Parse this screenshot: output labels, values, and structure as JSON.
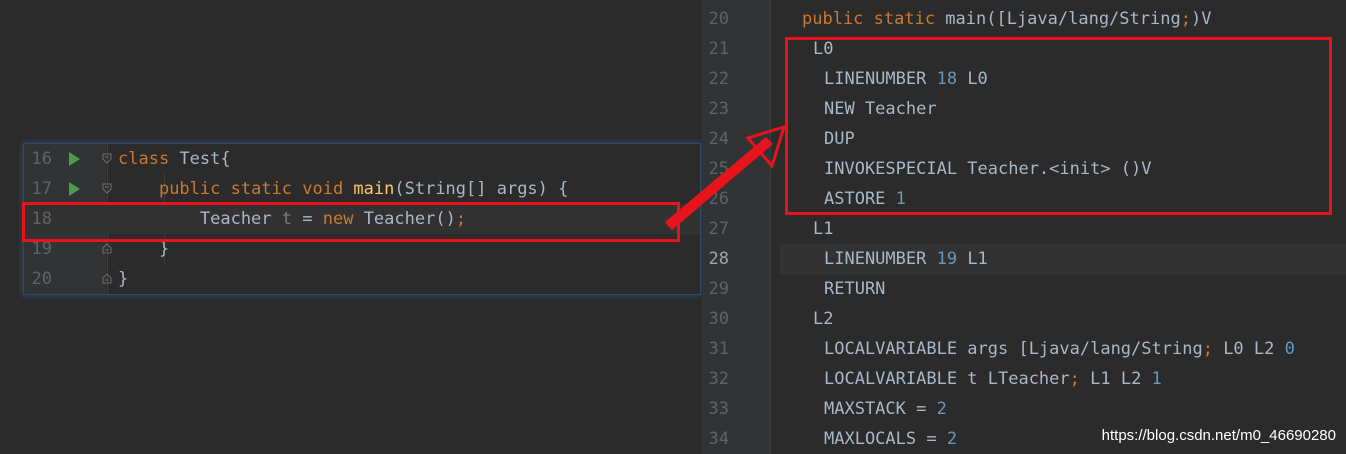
{
  "left_editor": {
    "lines": [
      {
        "num": "16",
        "run": true,
        "tokens": [
          [
            "kw",
            "class"
          ],
          [
            "txt",
            " Test{"
          ]
        ]
      },
      {
        "num": "17",
        "run": true,
        "tokens": [
          [
            "txt",
            "    "
          ],
          [
            "kw",
            "public static void "
          ],
          [
            "fn",
            "main"
          ],
          [
            "txt",
            "(String[] args) {"
          ]
        ]
      },
      {
        "num": "18",
        "run": false,
        "tokens": [
          [
            "txt",
            "        Teacher "
          ],
          [
            "dim",
            "t"
          ],
          [
            "txt",
            " = "
          ],
          [
            "kw",
            "new"
          ],
          [
            "txt",
            " Teacher()"
          ],
          [
            "kw",
            ";"
          ]
        ]
      },
      {
        "num": "19",
        "run": false,
        "tokens": [
          [
            "txt",
            "    }"
          ]
        ]
      },
      {
        "num": "20",
        "run": false,
        "tokens": [
          [
            "txt",
            "}"
          ]
        ]
      }
    ]
  },
  "bytecode": {
    "lines": [
      {
        "num": "20",
        "indent": 0,
        "tokens": [
          [
            "kw",
            "public static "
          ],
          [
            "txt",
            "main([Ljava/lang/String"
          ],
          [
            "kw",
            ";"
          ],
          [
            "txt",
            ")V"
          ]
        ]
      },
      {
        "num": "21",
        "indent": 1,
        "tokens": [
          [
            "txt",
            "L0"
          ]
        ]
      },
      {
        "num": "22",
        "indent": 2,
        "tokens": [
          [
            "txt",
            "LINENUMBER "
          ],
          [
            "num",
            "18"
          ],
          [
            "txt",
            " L0"
          ]
        ]
      },
      {
        "num": "23",
        "indent": 2,
        "tokens": [
          [
            "txt",
            "NEW Teacher"
          ]
        ]
      },
      {
        "num": "24",
        "indent": 2,
        "tokens": [
          [
            "txt",
            "DUP"
          ]
        ]
      },
      {
        "num": "25",
        "indent": 2,
        "tokens": [
          [
            "txt",
            "INVOKESPECIAL Teacher.<init> ()V"
          ]
        ]
      },
      {
        "num": "26",
        "indent": 2,
        "tokens": [
          [
            "txt",
            "ASTORE "
          ],
          [
            "num",
            "1"
          ]
        ]
      },
      {
        "num": "27",
        "indent": 1,
        "tokens": [
          [
            "txt",
            "L1"
          ]
        ]
      },
      {
        "num": "28",
        "indent": 2,
        "tokens": [
          [
            "txt",
            "LINENUMBER "
          ],
          [
            "num",
            "19"
          ],
          [
            "txt",
            " L1"
          ]
        ]
      },
      {
        "num": "29",
        "indent": 2,
        "tokens": [
          [
            "txt",
            "RETURN"
          ]
        ]
      },
      {
        "num": "30",
        "indent": 1,
        "tokens": [
          [
            "txt",
            "L2"
          ]
        ]
      },
      {
        "num": "31",
        "indent": 2,
        "tokens": [
          [
            "txt",
            "LOCALVARIABLE args [Ljava/lang/String"
          ],
          [
            "kw",
            ";"
          ],
          [
            "txt",
            " L0 L2 "
          ],
          [
            "num",
            "0"
          ]
        ]
      },
      {
        "num": "32",
        "indent": 2,
        "tokens": [
          [
            "txt",
            "LOCALVARIABLE t LTeacher"
          ],
          [
            "kw",
            ";"
          ],
          [
            "txt",
            " L1 L2 "
          ],
          [
            "num",
            "1"
          ]
        ]
      },
      {
        "num": "33",
        "indent": 2,
        "tokens": [
          [
            "txt",
            "MAXSTACK = "
          ],
          [
            "num",
            "2"
          ]
        ]
      },
      {
        "num": "34",
        "indent": 2,
        "tokens": [
          [
            "txt",
            "MAXLOCALS = "
          ],
          [
            "num",
            "2"
          ]
        ]
      }
    ]
  },
  "colors": {
    "background": "#2b2b2b",
    "keyword": "#cc7832",
    "number": "#6897bb",
    "function": "#ffc66d",
    "default_text": "#a9b7c6",
    "annotation_red": "#e8141c",
    "run_icon": "#499c54"
  },
  "icons": {
    "run": "play-triangle-icon",
    "fold": "fold-marker-icon"
  },
  "watermark": "https://blog.csdn.net/m0_46690280"
}
